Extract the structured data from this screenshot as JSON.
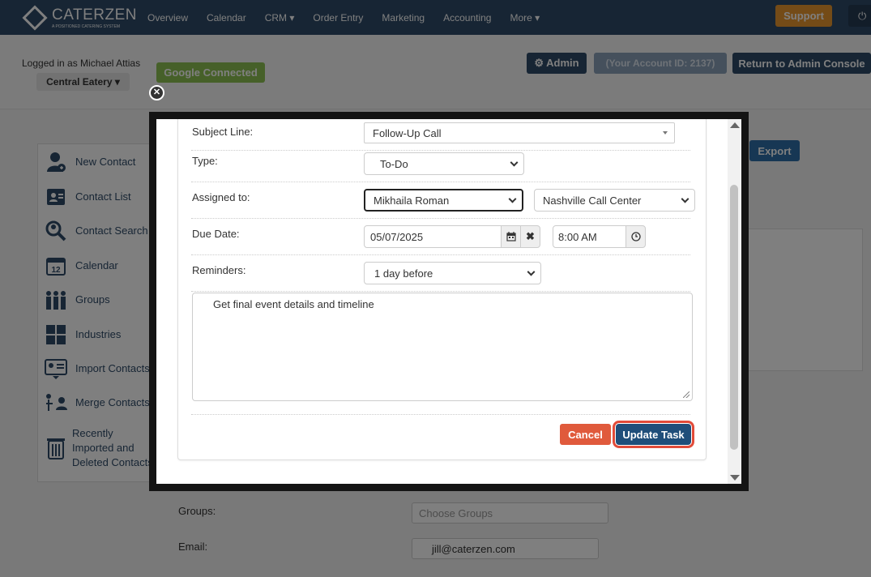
{
  "nav": {
    "brand": "CATERZEN",
    "brand_sub": "A POSITIONED CATERING SYSTEM",
    "items": [
      "Overview",
      "Calendar",
      "CRM ▾",
      "Order Entry",
      "Marketing",
      "Accounting",
      "More ▾"
    ],
    "support": "Support"
  },
  "header": {
    "logged_in": "Logged in as Michael Attias",
    "location": "Central Eatery ▾",
    "google": "Google Connected",
    "admin": "⚙ Admin",
    "account_id": "(Your Account ID: 2137)",
    "return": "Return to Admin Console"
  },
  "sidebar": {
    "items": [
      {
        "label": "New Contact",
        "icon": "add-user-icon"
      },
      {
        "label": "Contact List",
        "icon": "contact-card-icon"
      },
      {
        "label": "Contact Search",
        "icon": "search-user-icon"
      },
      {
        "label": "Calendar",
        "icon": "calendar-icon"
      },
      {
        "label": "Groups",
        "icon": "group-icon"
      },
      {
        "label": "Industries",
        "icon": "industries-icon"
      },
      {
        "label": "Import Contacts",
        "icon": "import-icon"
      },
      {
        "label": "Merge Contacts",
        "icon": "merge-icon"
      },
      {
        "label": "Recently Imported and Deleted Contacts",
        "icon": "trash-icon"
      }
    ]
  },
  "background_form": {
    "export": "Export",
    "groups_label": "Groups:",
    "groups_placeholder": "Choose Groups",
    "email_label": "Email:",
    "email_value": "jill@caterzen.com"
  },
  "task_form": {
    "subject_label": "Subject Line:",
    "subject_value": "Follow-Up Call",
    "type_label": "Type:",
    "type_value": "To-Do",
    "assigned_label": "Assigned to:",
    "assigned_value": "Mikhaila Roman",
    "location_value": "Nashville Call Center",
    "due_label": "Due Date:",
    "due_date": "05/07/2025",
    "due_time": "8:00 AM",
    "reminders_label": "Reminders:",
    "reminders_value": "1 day before",
    "notes": "Get final event details and timeline",
    "cancel": "Cancel",
    "update": "Update Task"
  },
  "colors": {
    "nav_bg": "#2f4b68",
    "cancel": "#e05a3c",
    "update": "#1f4e7a",
    "highlight": "#e14b39"
  }
}
